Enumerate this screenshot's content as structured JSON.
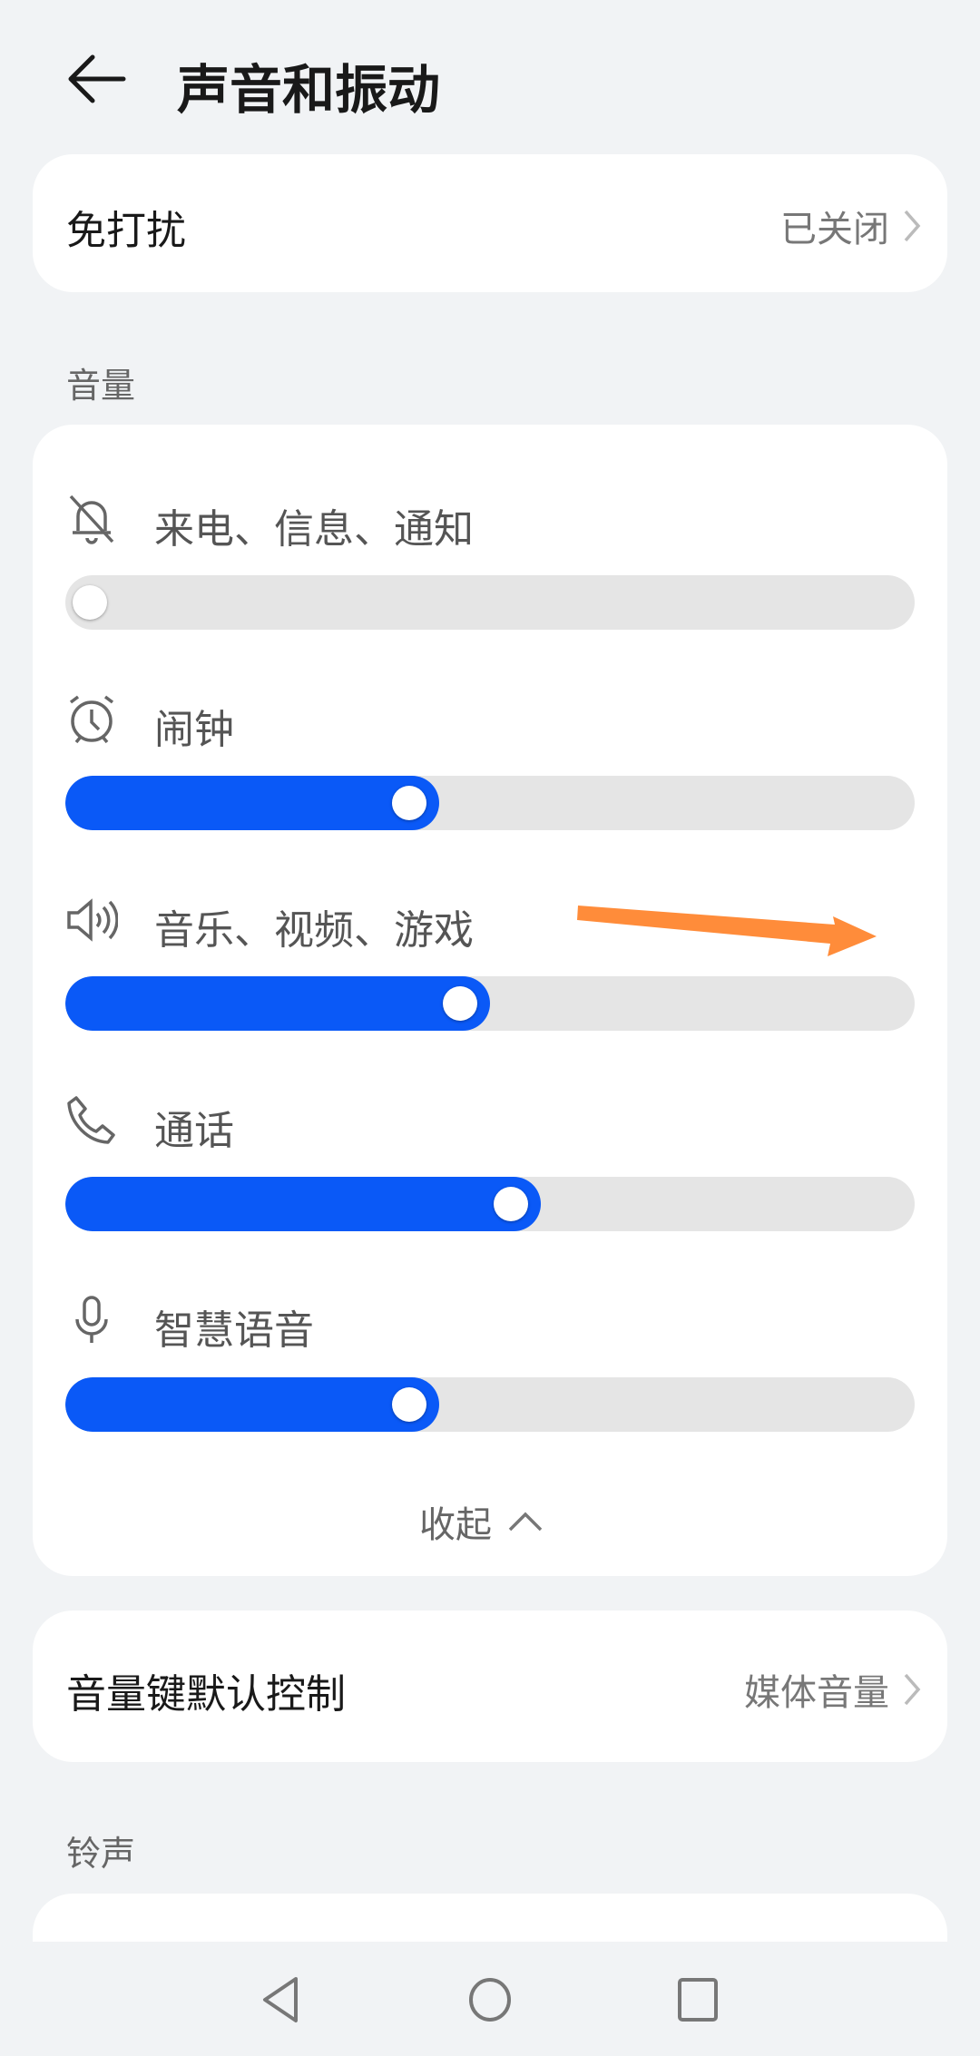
{
  "header": {
    "title": "声音和振动",
    "back_icon": "arrow-left-icon"
  },
  "dnd": {
    "label": "免打扰",
    "value": "已关闭"
  },
  "volume_section": {
    "title": "音量",
    "items": [
      {
        "label": "来电、信息、通知",
        "icon": "bell-off-icon",
        "level": 0
      },
      {
        "label": "闹钟",
        "icon": "alarm-clock-icon",
        "level": 0.44
      },
      {
        "label": "音乐、视频、游戏",
        "icon": "speaker-icon",
        "level": 0.5
      },
      {
        "label": "通话",
        "icon": "phone-icon",
        "level": 0.56
      },
      {
        "label": "智慧语音",
        "icon": "microphone-icon",
        "level": 0.44
      }
    ],
    "collapse_label": "收起"
  },
  "volume_key": {
    "label": "音量键默认控制",
    "value": "媒体音量"
  },
  "ringtone_section": {
    "title": "铃声"
  },
  "colors": {
    "accent": "#0a59f7",
    "annotation_arrow": "#ff8c3a",
    "background": "#f1f3f5"
  }
}
